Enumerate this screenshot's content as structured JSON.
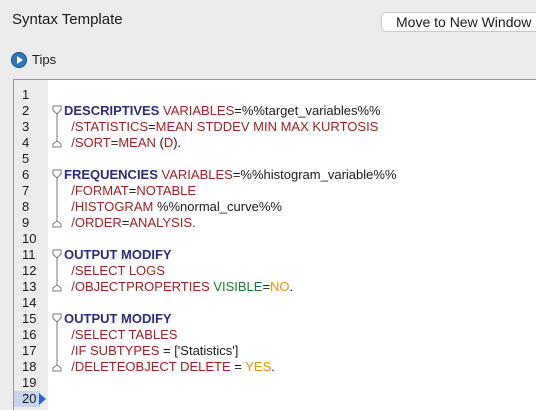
{
  "window": {
    "title": "Syntax Template",
    "move_button_label": "Move to New Window"
  },
  "tips": {
    "label": "Tips",
    "icon": "play-icon"
  },
  "editor": {
    "current_line": 20,
    "line_numbers": [
      "1",
      "2",
      "3",
      "4",
      "5",
      "6",
      "7",
      "8",
      "9",
      "10",
      "11",
      "12",
      "13",
      "14",
      "15",
      "16",
      "17",
      "18",
      "19",
      "20"
    ],
    "lines": [
      [],
      [
        {
          "t": "DESCRIPTIVES",
          "c": "kw"
        },
        {
          "t": " ",
          "c": "txt"
        },
        {
          "t": "VARIABLES",
          "c": "sub"
        },
        {
          "t": "=%%target_variables%%",
          "c": "txt"
        }
      ],
      [
        {
          "t": "  /STATISTICS",
          "c": "sub"
        },
        {
          "t": "=",
          "c": "op"
        },
        {
          "t": "MEAN STDDEV MIN MAX KURTOSIS",
          "c": "val"
        }
      ],
      [
        {
          "t": "  /SORT",
          "c": "sub"
        },
        {
          "t": "=",
          "c": "op"
        },
        {
          "t": "MEAN",
          "c": "val"
        },
        {
          "t": " (",
          "c": "txt"
        },
        {
          "t": "D",
          "c": "val"
        },
        {
          "t": ").",
          "c": "txt"
        }
      ],
      [],
      [
        {
          "t": "FREQUENCIES",
          "c": "kw"
        },
        {
          "t": " ",
          "c": "txt"
        },
        {
          "t": "VARIABLES",
          "c": "sub"
        },
        {
          "t": "=%%histogram_variable%%",
          "c": "txt"
        }
      ],
      [
        {
          "t": "  /FORMAT",
          "c": "sub"
        },
        {
          "t": "=",
          "c": "op"
        },
        {
          "t": "NOTABLE",
          "c": "val"
        }
      ],
      [
        {
          "t": "  /HISTOGRAM",
          "c": "sub"
        },
        {
          "t": " %%normal_curve%%",
          "c": "txt"
        }
      ],
      [
        {
          "t": "  /ORDER",
          "c": "sub"
        },
        {
          "t": "=",
          "c": "op"
        },
        {
          "t": "ANALYSIS",
          "c": "val"
        },
        {
          "t": ".",
          "c": "txt"
        }
      ],
      [],
      [
        {
          "t": "OUTPUT MODIFY",
          "c": "kw"
        }
      ],
      [
        {
          "t": "  /SELECT",
          "c": "sub"
        },
        {
          "t": " ",
          "c": "txt"
        },
        {
          "t": "LOGS",
          "c": "val"
        }
      ],
      [
        {
          "t": "  /OBJECTPROPERTIES",
          "c": "sub"
        },
        {
          "t": " ",
          "c": "txt"
        },
        {
          "t": "VISIBLE",
          "c": "green"
        },
        {
          "t": "=",
          "c": "op"
        },
        {
          "t": "NO",
          "c": "orange"
        },
        {
          "t": ".",
          "c": "txt"
        }
      ],
      [],
      [
        {
          "t": "OUTPUT MODIFY",
          "c": "kw"
        }
      ],
      [
        {
          "t": "  /SELECT",
          "c": "sub"
        },
        {
          "t": " ",
          "c": "txt"
        },
        {
          "t": "TABLES",
          "c": "val"
        }
      ],
      [
        {
          "t": "  /IF",
          "c": "sub"
        },
        {
          "t": " ",
          "c": "txt"
        },
        {
          "t": "SUBTYPES",
          "c": "sub"
        },
        {
          "t": " = ['Statistics']",
          "c": "txt"
        }
      ],
      [
        {
          "t": "  /DELETEOBJECT",
          "c": "sub"
        },
        {
          "t": " ",
          "c": "txt"
        },
        {
          "t": "DELETE",
          "c": "val"
        },
        {
          "t": " = ",
          "c": "txt"
        },
        {
          "t": "YES",
          "c": "orange"
        },
        {
          "t": ".",
          "c": "txt"
        }
      ],
      [],
      []
    ],
    "fold_markers": [
      {
        "line": 2,
        "type": "start"
      },
      {
        "line": 3,
        "type": "mid"
      },
      {
        "line": 4,
        "type": "end"
      },
      {
        "line": 6,
        "type": "start"
      },
      {
        "line": 7,
        "type": "mid"
      },
      {
        "line": 8,
        "type": "mid"
      },
      {
        "line": 9,
        "type": "end"
      },
      {
        "line": 11,
        "type": "start"
      },
      {
        "line": 12,
        "type": "mid"
      },
      {
        "line": 13,
        "type": "end"
      },
      {
        "line": 15,
        "type": "start"
      },
      {
        "line": 16,
        "type": "mid"
      },
      {
        "line": 17,
        "type": "mid"
      },
      {
        "line": 18,
        "type": "end"
      }
    ]
  },
  "colors": {
    "keyword": "#2b2b7a",
    "subcommand": "#a01f1f",
    "value_green": "#1e7a2a",
    "value_orange": "#e89400",
    "current_line": "#2a64c8"
  }
}
